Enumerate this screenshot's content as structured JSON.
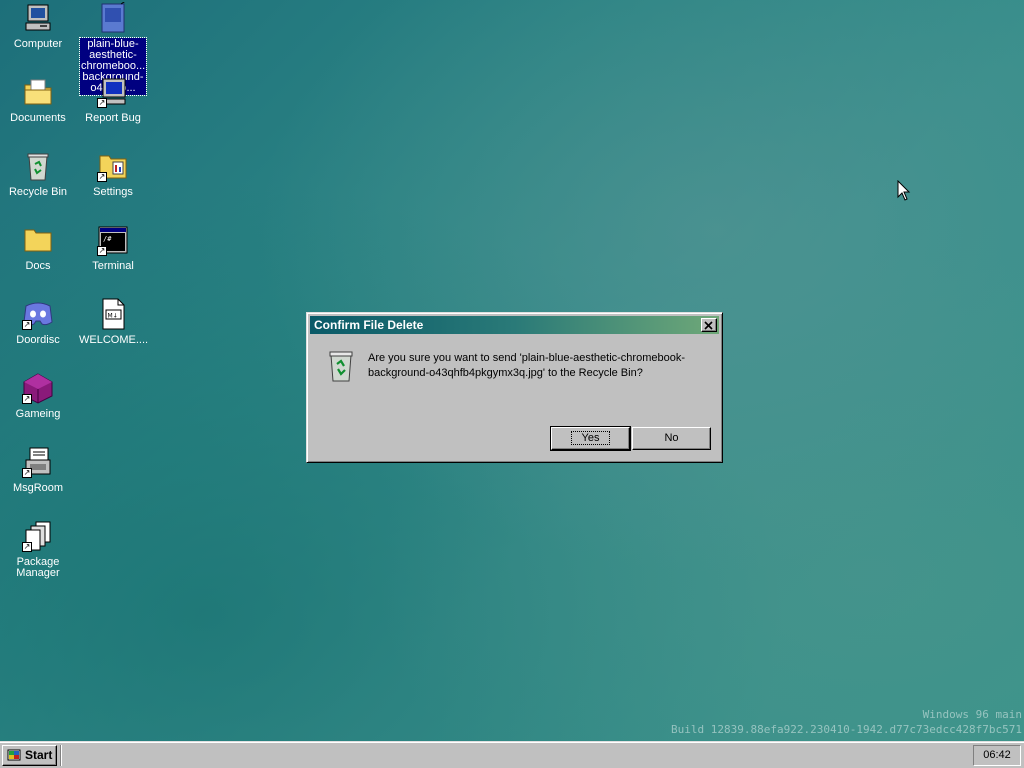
{
  "desktop": {
    "icons": [
      {
        "label": "Computer",
        "icon": "computer-icon"
      },
      {
        "label": "plain-blue-aesthetic-chromeboo... background-o43...jp...",
        "icon": "image-file-icon",
        "selected": true
      },
      {
        "label": "Documents",
        "icon": "folder-documents-icon"
      },
      {
        "label": "Report Bug",
        "icon": "report-bug-icon"
      },
      {
        "label": "Recycle Bin",
        "icon": "recycle-bin-icon"
      },
      {
        "label": "Settings",
        "icon": "settings-icon"
      },
      {
        "label": "Docs",
        "icon": "folder-icon"
      },
      {
        "label": "Terminal",
        "icon": "terminal-icon"
      },
      {
        "label": "Doordisc",
        "icon": "doordisc-icon"
      },
      {
        "label": "WELCOME....",
        "icon": "markdown-file-icon"
      },
      {
        "label": "Gameing",
        "icon": "gameing-icon"
      },
      {
        "label": "MsgRoom",
        "icon": "msgroom-icon"
      },
      {
        "label": "Package Manager",
        "icon": "package-manager-icon"
      }
    ],
    "selected_label_lines": [
      "plain-blue-",
      "aesthetic-",
      "chromeboo...",
      "background-",
      "o43...jp..."
    ],
    "watermark_line1": "Windows 96 main",
    "watermark_line2": "Build 12839.88efa922.230410-1942.d77c73edcc428f7bc571"
  },
  "dialog": {
    "title": "Confirm File Delete",
    "message": "Are you sure you want to send 'plain-blue-aesthetic-chromebook-background-o43qhfb4pkgymx3q.jpg' to the Recycle Bin?",
    "yes_label": "Yes",
    "no_label": "No",
    "close_symbol": "✕"
  },
  "taskbar": {
    "start_label": "Start",
    "clock": "06:42"
  },
  "colors": {
    "title_start": "#0a5a68",
    "title_end": "#6fa878",
    "face": "#c0c0c0",
    "selection": "#000080"
  }
}
